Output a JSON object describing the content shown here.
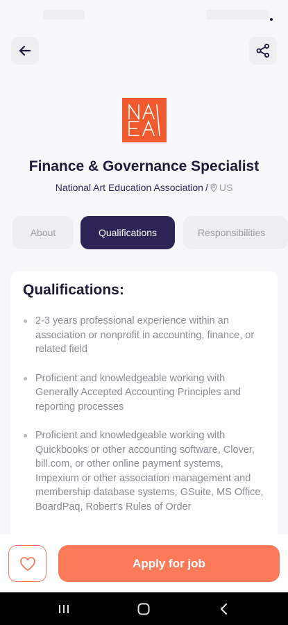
{
  "job": {
    "title": "Finance & Governance Specialist",
    "company": "National Art Education Association",
    "separator": "/",
    "location": "US",
    "logo_text": "NAEA"
  },
  "tabs": [
    {
      "label": "About",
      "active": false
    },
    {
      "label": "Qualifications",
      "active": true
    },
    {
      "label": "Responsibilities",
      "active": false
    }
  ],
  "qualifications": {
    "heading": "Qualifications:",
    "items": [
      "2-3 years professional experience within an association or nonprofit in accounting, finance, or related field",
      "Proficient and knowledgeable working with Generally Accepted Accounting Principles and reporting processes",
      "Proficient and knowledgeable working with Quickbooks or other accounting software, Clover, bill.com, or other online payment systems, Impexium or other association management and membership database systems, GSuite, MS Office, BoardPaq, Robert's Rules of Order"
    ]
  },
  "actions": {
    "apply_label": "Apply for job",
    "favorite_icon": "heart-icon"
  },
  "icons": {
    "back": "arrow-left-icon",
    "share": "share-icon",
    "location": "map-pin-icon"
  },
  "colors": {
    "accent": "#fa7a59",
    "active_tab": "#2e2556",
    "logo_bg": "#ef5a2f",
    "text_primary": "#1d1a3a",
    "text_muted": "#8a8a94"
  }
}
